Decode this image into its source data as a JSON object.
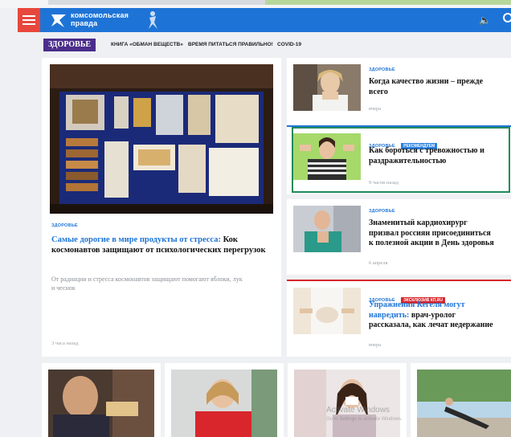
{
  "header": {
    "logo_line1": "комсомольская",
    "logo_line2": "правда"
  },
  "rubric": {
    "title": "ЗДОРОВЬЕ",
    "subnav": [
      "КНИГА «ОБМАН ВЕЩЕСТВ»",
      "ВРЕМЯ ПИТАТЬСЯ ПРАВИЛЬНО!",
      "COVID-19"
    ]
  },
  "main_article": {
    "tag": "ЗДОРОВЬЕ",
    "title_lead": "Самые дорогие в мире продукты от стресса:",
    "title_rest": " Кок космонавтов защищают от психологических перегрузок",
    "lead": "От радиации и стресса космонавтов защищают помогают яблоки, лук и чеснок",
    "time": "3 часа назад"
  },
  "side_articles": [
    {
      "tag": "ЗДОРОВЬЕ",
      "badge": "",
      "title_lead": "",
      "title": "Когда качество жизни – прежде всего",
      "title_line1": "Когда качество жизни – прежде",
      "title_line2": "всего",
      "title_line3": "",
      "time": "вчера"
    },
    {
      "tag": "ЗДОРОВЬЕ",
      "badge": "РЕКОМЕНДУЕМ",
      "title_line1": "Как бороться с тревожностью и",
      "title_line2": "раздражительностью",
      "title_line3": "",
      "time": "9 часов назад"
    },
    {
      "tag": "ЗДОРОВЬЕ",
      "badge": "",
      "title_line1": "Знаменитый кардиохирург",
      "title_line2": "призвал россиян присоединиться",
      "title_line3": "к полезной акции в День здоровья",
      "time": "6 апреля"
    },
    {
      "tag": "ЗДОРОВЬЕ",
      "badge": "ЭКСКЛЮЗИВ КП.RU",
      "title_line1": "Упражнения Кегеля могут",
      "title_line2_lead": "навредить:",
      "title_line2_rest": " врач-уролог",
      "title_line3": "рассказала, как лечат недержание",
      "time": "вчера"
    }
  ],
  "watermark": {
    "line1": "Activate Windows",
    "line2": "Go to Settings to activate Windows."
  },
  "colors": {
    "header_blue": "#1e74d6",
    "menu_red": "#e8473c",
    "rubric_purple": "#4a2d8a",
    "badge_blue": "#2a80e0",
    "badge_red": "#d8262c",
    "active_green": "#1f8a5a"
  }
}
